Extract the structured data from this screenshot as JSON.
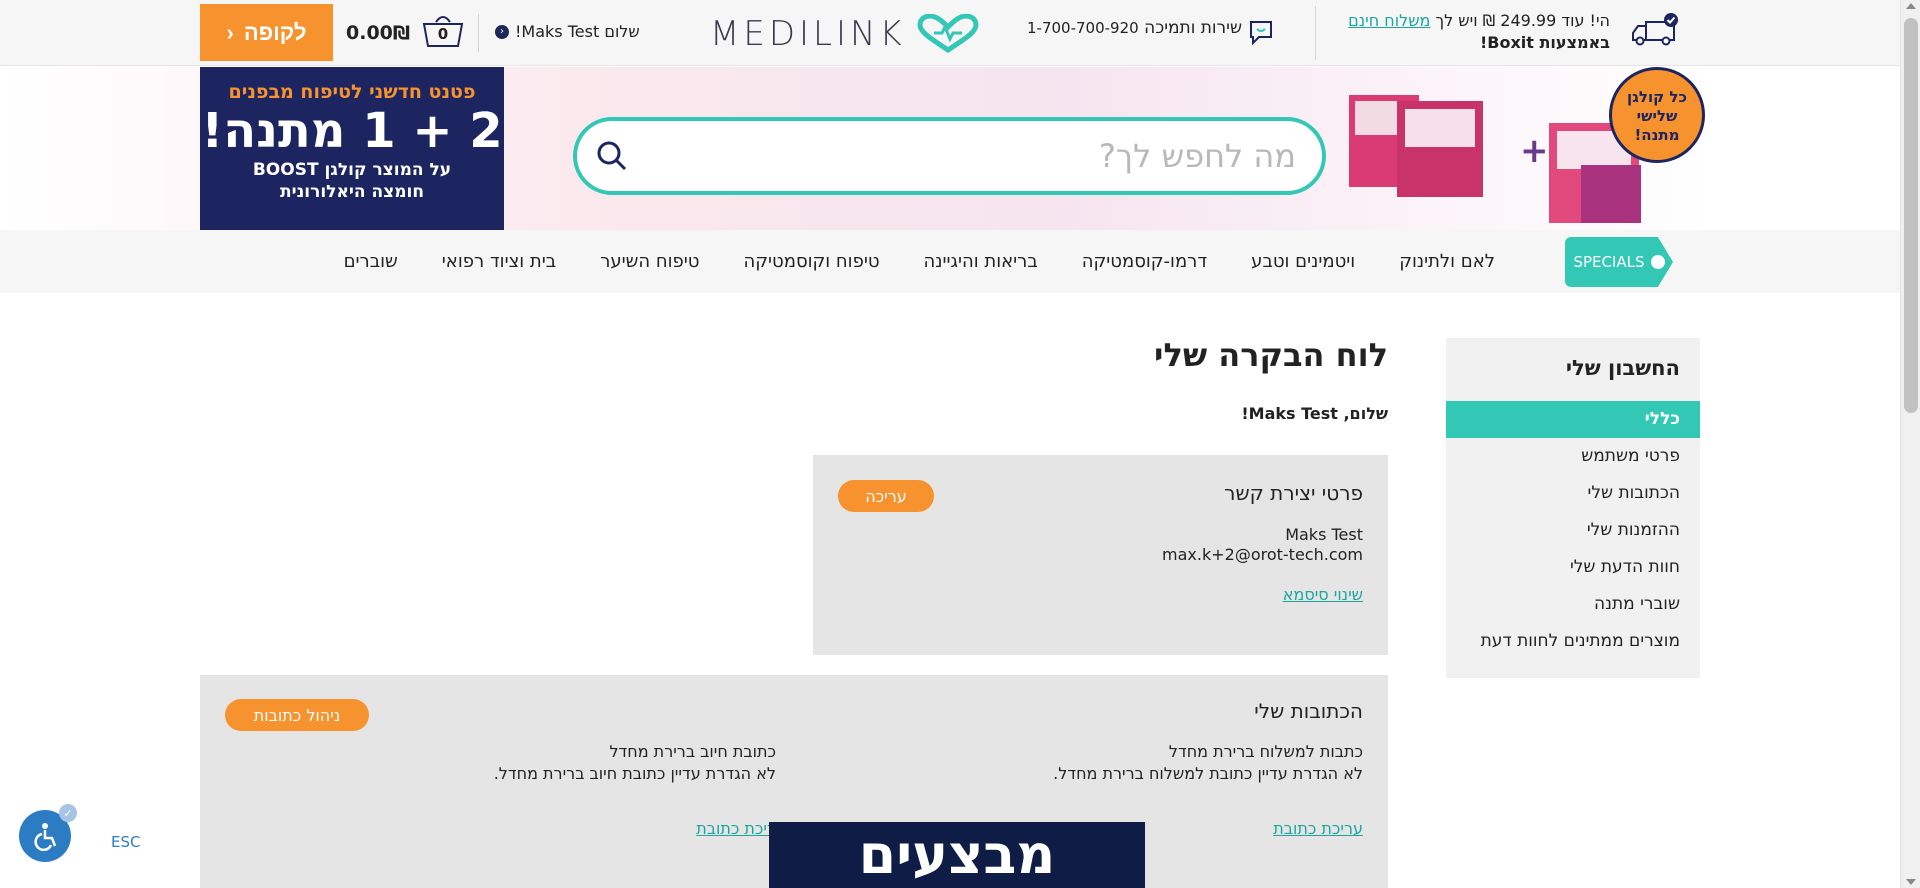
{
  "topbar": {
    "shipping_prefix": "הי! עוד",
    "shipping_amount": "249.99 ₪",
    "shipping_middle": "ויש לך",
    "shipping_link": "משלוח חינם",
    "shipping_suffix": "באמצעות Boxit!",
    "service_label": "שירות ותמיכה",
    "service_phone": "1-700-700-920",
    "logo_text": "MEDILINK",
    "hello": "שלום Maks Test!",
    "basket_count": "0",
    "total": "0.00₪",
    "checkout_label": "לקופה",
    "icons": {
      "truck": "delivery-truck-icon",
      "chat": "chat-bubble-icon",
      "basket": "basket-icon",
      "chevron": "chevron-left-icon"
    }
  },
  "banner": {
    "promo_line1": "פטנט חדשני לטיפוח מבפנים",
    "promo_line2": "2 + 1 מתנה!",
    "promo_line3": "על המוצר קולגן BOOST",
    "promo_line4": "חומצה היאלורונית",
    "search_placeholder": "מה לחפש לך?",
    "badge_line1": "כל קולגן",
    "badge_line2": "שלישי",
    "badge_line3": "מתנה!",
    "plus": "+"
  },
  "nav": {
    "specials": "SPECIALS",
    "items": [
      "לאם ולתינוק",
      "ויטמינים וטבע",
      "דרמו-קוסמטיקה",
      "בריאות והיגיינה",
      "טיפוח וקוסמטיקה",
      "טיפוח השיער",
      "בית וציוד רפואי",
      "שוברים"
    ]
  },
  "sidebar": {
    "title": "החשבון שלי",
    "items": [
      "כללי",
      "פרטי משתמש",
      "הכתובות שלי",
      "ההזמנות שלי",
      "חוות הדעת שלי",
      "שוברי מתנה",
      "מוצרים ממתינים לחוות דעת"
    ],
    "active_index": 0
  },
  "main": {
    "title": "לוח הבקרה שלי",
    "greeting": "שלום, Maks Test!"
  },
  "contact": {
    "title": "פרטי יצירת קשר",
    "edit_label": "עריכה",
    "name": "Maks Test",
    "email": "max.k+2@orot-tech.com",
    "change_password": "שינוי סיסמא"
  },
  "addresses": {
    "title": "הכתובות שלי",
    "manage_label": "ניהול כתובות",
    "shipping_title": "כתבות למשלוח ברירת מחדל",
    "shipping_text": "לא הגדרת עדיין כתובת למשלוח ברירת מחדל.",
    "shipping_edit": "עריכת כתובת",
    "billing_title": "כתובת חיוב ברירת מחדל",
    "billing_text": "לא הגדרת עדיין כתובת חיוב ברירת מחדל.",
    "billing_edit": "ריכת כתובת"
  },
  "popup": {
    "text": "מבצעים"
  },
  "accessibility": {
    "esc": "ESC"
  },
  "colors": {
    "accent_teal": "#33c7b6",
    "accent_orange": "#f7932e",
    "navy": "#1d2560",
    "link": "#1aa7a0"
  }
}
